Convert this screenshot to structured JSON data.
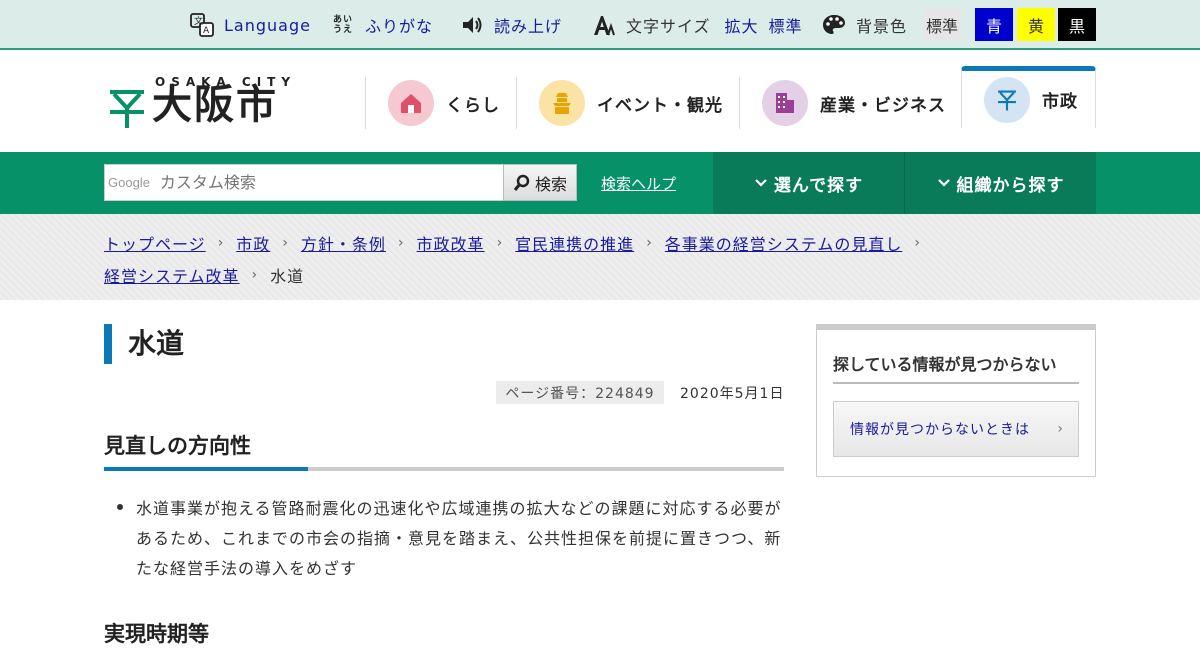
{
  "utility": {
    "language": "Language",
    "furigana": "ふりがな",
    "furigana_icon_text": "あいうえ",
    "read_aloud": "読み上げ",
    "text_size_label": "文字サイズ",
    "text_size_large": "拡大",
    "text_size_normal": "標準",
    "bg_label": "背景色",
    "bg_options": [
      {
        "label": "標準",
        "bg": "#e6e6e6",
        "fg": "#333333"
      },
      {
        "label": "青",
        "bg": "#0000cc",
        "fg": "#ffffff"
      },
      {
        "label": "黄",
        "bg": "#ffff00",
        "fg": "#333333"
      },
      {
        "label": "黒",
        "bg": "#000000",
        "fg": "#ffffff"
      }
    ]
  },
  "header": {
    "logo_sub": "OSAKA CITY",
    "logo_text": "大阪市",
    "nav": [
      {
        "label": "くらし",
        "icon": "house-icon",
        "circle": "#f5c9cf"
      },
      {
        "label": "イベント・観光",
        "icon": "castle-icon",
        "circle": "#fbe3a6"
      },
      {
        "label": "産業・ビジネス",
        "icon": "building-icon",
        "circle": "#e4d0e6"
      },
      {
        "label": "市政",
        "icon": "city-mark-icon",
        "circle": "#d4e4f3"
      }
    ]
  },
  "search": {
    "google_tag": "Google",
    "placeholder": "カスタム検索",
    "button": "検索",
    "help": "検索ヘルプ",
    "find_by_choice": "選んで探す",
    "find_by_org": "組織から探す"
  },
  "breadcrumb": {
    "line1": [
      "トップページ",
      "市政",
      "方針・条例",
      "市政改革",
      "官民連携の推進",
      "各事業の経営システムの見直し"
    ],
    "line2_link": "経営システム改革",
    "current": "水道"
  },
  "main": {
    "title": "水道",
    "page_no": "ページ番号：224849",
    "date": "2020年5月1日",
    "section1": "見直しの方向性",
    "bullet1": "水道事業が抱える管路耐震化の迅速化や広域連携の拡大などの課題に対応する必要があるため、これまでの市会の指摘・意見を踏まえ、公共性担保を前提に置きつつ、新たな経営手法の導入をめざす",
    "section2": "実現時期等"
  },
  "sidebar": {
    "title": "探している情報が見つからない",
    "button": "情報が見つからないときは"
  },
  "colors": {
    "green": "#079169",
    "accent_blue": "#0b78b8",
    "link": "#1a1a9e"
  }
}
